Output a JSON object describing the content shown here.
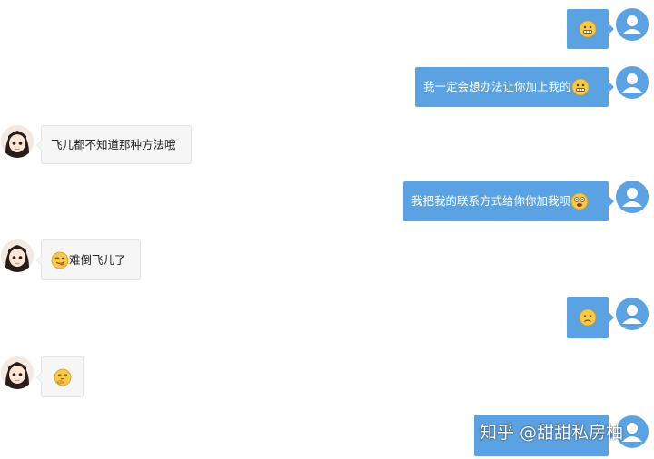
{
  "colors": {
    "user_bubble": "#5aa2e2",
    "other_bubble": "#f6f6f6",
    "background": "#ffffff"
  },
  "messages": [
    {
      "sender": "me",
      "text": "",
      "emoji": "grimace-emoji"
    },
    {
      "sender": "me",
      "text": "我一定会想办法让你加上我的",
      "emoji": "grimace-emoji"
    },
    {
      "sender": "other",
      "text": "飞儿都不知道那种方法哦",
      "emoji": ""
    },
    {
      "sender": "me",
      "text": "我把我的联系方式给你你加我呗",
      "emoji": "shocked-emoji"
    },
    {
      "sender": "other",
      "text": "难倒飞儿了",
      "emoji": "wink-tongue-emoji"
    },
    {
      "sender": "me",
      "text": "",
      "emoji": "frown-emoji"
    },
    {
      "sender": "other",
      "text": "",
      "emoji": "thinking-emoji"
    },
    {
      "sender": "me",
      "text": "",
      "emoji": ""
    }
  ],
  "watermark": "知乎 @甜甜私房柚"
}
